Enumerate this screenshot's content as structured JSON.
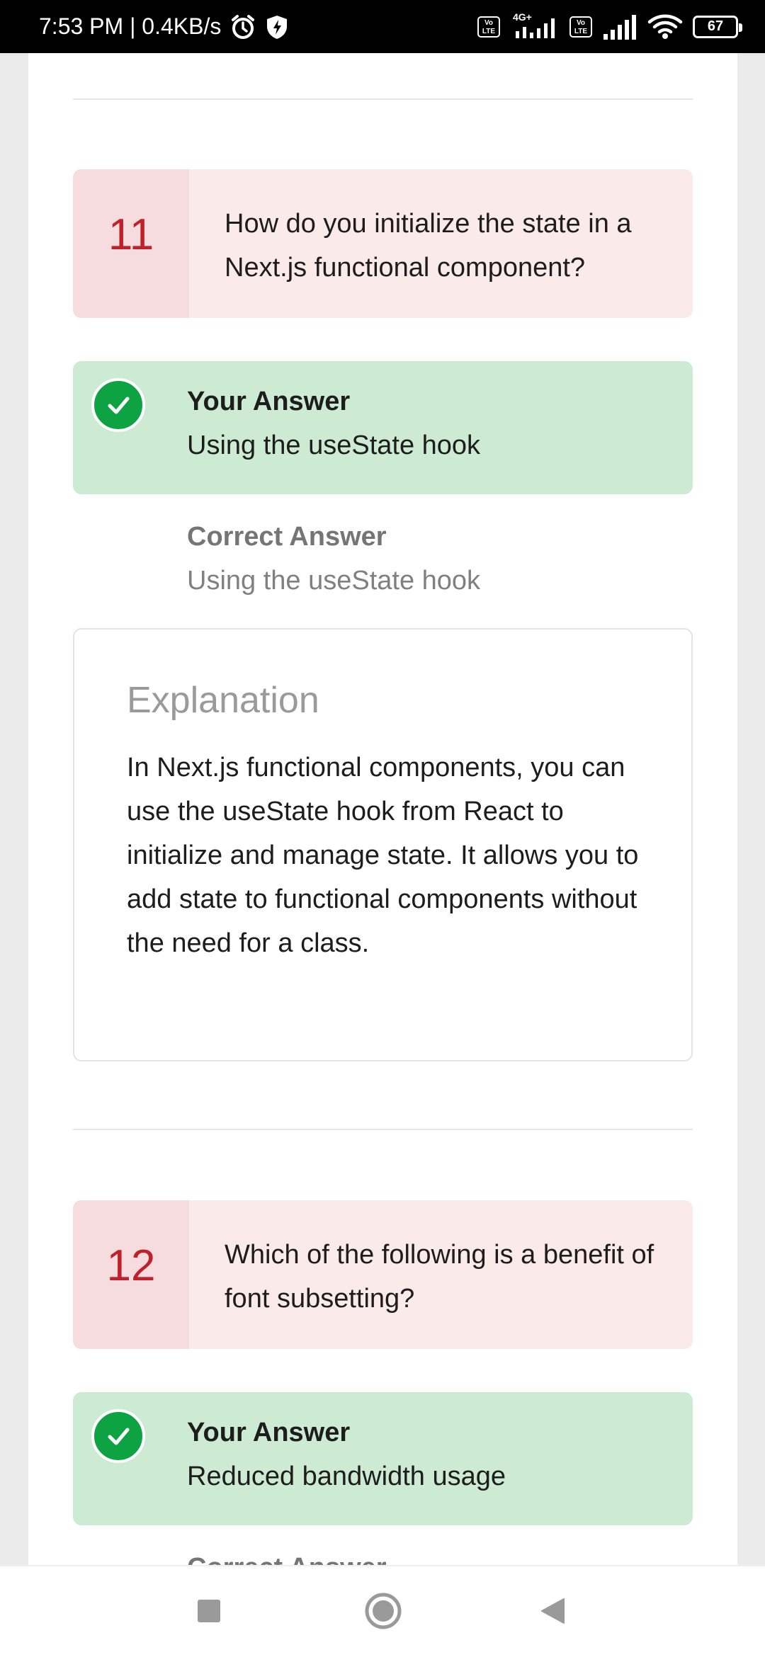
{
  "status_bar": {
    "time_speed": "7:53 PM | 0.4KB/s",
    "network_badge": "4G+",
    "volte_label": "Vo\nLTE",
    "battery": "67"
  },
  "questions": [
    {
      "number": "11",
      "question": "How do you initialize the state in a Next.js functional component?",
      "your_answer_label": "Your Answer",
      "your_answer": "Using the useState hook",
      "correct_answer_label": "Correct Answer",
      "correct_answer": "Using the useState hook",
      "explanation_title": "Explanation",
      "explanation": "In Next.js functional components, you can use the useState hook from React to initialize and manage state. It allows you to add state to functional components without the need for a class."
    },
    {
      "number": "12",
      "question": "Which of the following is a benefit of font subsetting?",
      "your_answer_label": "Your Answer",
      "your_answer": "Reduced bandwidth usage",
      "correct_answer_label": "Correct Answer"
    }
  ],
  "colors": {
    "question_number": "#c0202a",
    "question_bg": "#fbeaea",
    "answer_bg": "#cdebd3",
    "check": "#0ea342"
  },
  "icons": {
    "check": "check-icon",
    "recents": "square-icon",
    "home": "circle-icon",
    "back": "triangle-back-icon"
  }
}
